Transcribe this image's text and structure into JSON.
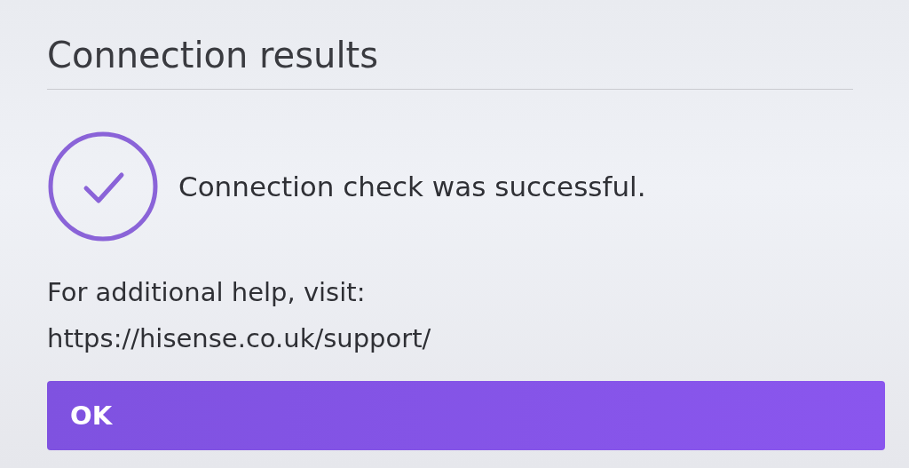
{
  "dialog": {
    "title": "Connection results"
  },
  "result": {
    "message": "Connection check was successful."
  },
  "help": {
    "lines": [
      "For additional help, visit:",
      "https://hisense.co.uk/support/"
    ]
  },
  "buttons": [
    "OK"
  ]
}
